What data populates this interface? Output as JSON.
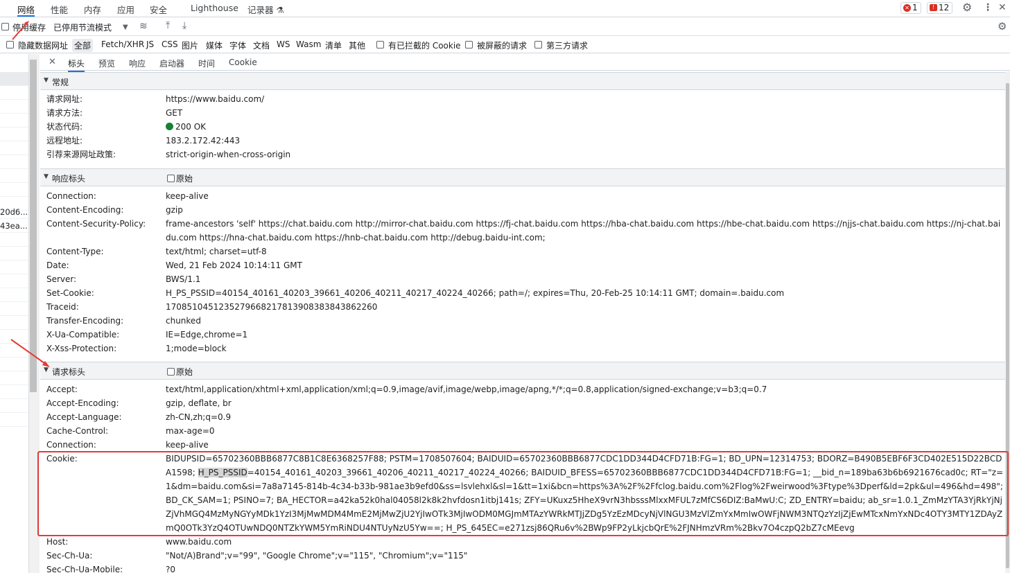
{
  "top_tabs": [
    "网络",
    "性能",
    "内存",
    "应用",
    "安全",
    "Lighthouse",
    "记录器"
  ],
  "badges": {
    "errors": "1",
    "issues": "12"
  },
  "toolbar1": {
    "disable_cache": "停用缓存",
    "throttle": "已停用节流模式"
  },
  "toolbar2": {
    "hide_data_urls": "隐藏数据网址",
    "filters": [
      "全部",
      "Fetch/XHR",
      "JS",
      "CSS",
      "图片",
      "媒体",
      "字体",
      "文档",
      "WS",
      "Wasm",
      "清单",
      "其他"
    ],
    "blocked_cookies": "有已拦截的 Cookie",
    "blocked_requests": "被屏蔽的请求",
    "third_party": "第三方请求"
  },
  "left_list": [
    "20d6...",
    "43ea..."
  ],
  "detail_tabs": [
    "标头",
    "预览",
    "响应",
    "启动器",
    "时间",
    "Cookie"
  ],
  "general": {
    "title": "常规",
    "rows": [
      {
        "k": "请求网址:",
        "v": "https://www.baidu.com/"
      },
      {
        "k": "请求方法:",
        "v": "GET"
      },
      {
        "k": "状态代码:",
        "v": "200 OK"
      },
      {
        "k": "远程地址:",
        "v": "183.2.172.42:443"
      },
      {
        "k": "引荐来源网址政策:",
        "v": "strict-origin-when-cross-origin"
      }
    ]
  },
  "response_headers": {
    "title": "响应标头",
    "raw": "原始",
    "rows": [
      {
        "k": "Connection:",
        "v": "keep-alive"
      },
      {
        "k": "Content-Encoding:",
        "v": "gzip"
      },
      {
        "k": "Content-Security-Policy:",
        "v": "frame-ancestors 'self' https://chat.baidu.com http://mirror-chat.baidu.com https://fj-chat.baidu.com https://hba-chat.baidu.com https://hbe-chat.baidu.com https://njjs-chat.baidu.com https://nj-chat.baidu.com https://hna-chat.baidu.com https://hnb-chat.baidu.com http://debug.baidu-int.com;"
      },
      {
        "k": "Content-Type:",
        "v": "text/html; charset=utf-8"
      },
      {
        "k": "Date:",
        "v": "Wed, 21 Feb 2024 10:14:11 GMT"
      },
      {
        "k": "Server:",
        "v": "BWS/1.1"
      },
      {
        "k": "Set-Cookie:",
        "v": "H_PS_PSSID=40154_40161_40203_39661_40206_40211_40217_40224_40266; path=/; expires=Thu, 20-Feb-25 10:14:11 GMT; domain=.baidu.com"
      },
      {
        "k": "Traceid:",
        "v": "170851045123527966821781390838384386​2260"
      },
      {
        "k": "Transfer-Encoding:",
        "v": "chunked"
      },
      {
        "k": "X-Ua-Compatible:",
        "v": "IE=Edge,chrome=1"
      },
      {
        "k": "X-Xss-Protection:",
        "v": "1;mode=block"
      }
    ]
  },
  "request_headers": {
    "title": "请求标头",
    "raw": "原始",
    "rows": [
      {
        "k": "Accept:",
        "v": "text/html,application/xhtml+xml,application/xml;q=0.9,image/avif,image/webp,image/apng,*/*;q=0.8,application/signed-exchange;v=b3;q=0.7"
      },
      {
        "k": "Accept-Encoding:",
        "v": "gzip, deflate, br"
      },
      {
        "k": "Accept-Language:",
        "v": "zh-CN,zh;q=0.9"
      },
      {
        "k": "Cache-Control:",
        "v": "max-age=0"
      },
      {
        "k": "Connection:",
        "v": "keep-alive"
      }
    ],
    "cookie_key": "Cookie:",
    "cookie_line1": "BIDUPSID=65702360BBB6877C8B1C8E6368257F88; PSTM=1708507604; BAIDUID=65702360BBB6877CDC1DD344D4CFD71B:FG=1; BD_UPN=12314753; BDORZ=B490B5EBF6F3CD402E515D22BCDA1598;",
    "cookie_highlight": "H_PS_PSSID",
    "cookie_line2_rest": "=40154_40161_40203_39661_40206_40211_40217_40224_40266; BAIDUID_BFESS=65702360BBB6877CDC1DD344D4CFD71B:FG=1; __bid_n=189ba63b6b6921676cad0c; RT=\"z=1&dm=baidu.com&si=7a8a7145-814b-4c34-b33b-981ae3b9efd0&ss=lsvlehxl&sl=1&tt=1xi&bcn=https%3A%2F%2Ffclog.baidu.com%2Flog%2Fweirwood%3Ftype%3Dperf&ld=2pk&ul=496&hd=498\"; BD_CK_SAM=1; PSINO=7; BA_HECTOR=a42ka52k0hal04058l2k8k2hvfdosn1itbj141s; ZFY=UKuxz5HheX9vrN3hbsssMlxxMFUL7zMfCS6DIZ:BaMwU:C; ZD_ENTRY=baidu; ab_sr=1.0.1_ZmMzYTA3YjRkYjNjZjVhMGQ4MzMyNGYyMDk1YzI3MjMwMDM4MmE2MjMwZjU2YjIwOTk3MjIwODM0MGJmMTAzYWRkMTJjZDg5YzEzMDcyNjVlNGU3MzVlZmYxMmIwOWFjNWM3NTQzYzIjZjEwMTcxNmYxNDc4OTY3MTY1ZDAyZmQ0OTk3YzQ4OTUwNDQ0NTZkYWM5YmRiNDU4NTUyNzU5Yw==; H_PS_645EC=e271zsj86QRu6v%2BWp9FP2yLkjcbQrE%2FJNHmzVRm%2Bkv7O4czpQ2bZ7cMEevg",
    "after_rows": [
      {
        "k": "Host:",
        "v": "www.baidu.com"
      },
      {
        "k": "Sec-Ch-Ua:",
        "v": "\"Not/A)Brand\";v=\"99\", \"Google Chrome\";v=\"115\", \"Chromium\";v=\"115\""
      },
      {
        "k": "Sec-Ch-Ua-Mobile:",
        "v": "?0"
      }
    ]
  },
  "colors": {
    "annotation": "#e53935",
    "ok": "#188038",
    "accent": "#1a73e8"
  }
}
